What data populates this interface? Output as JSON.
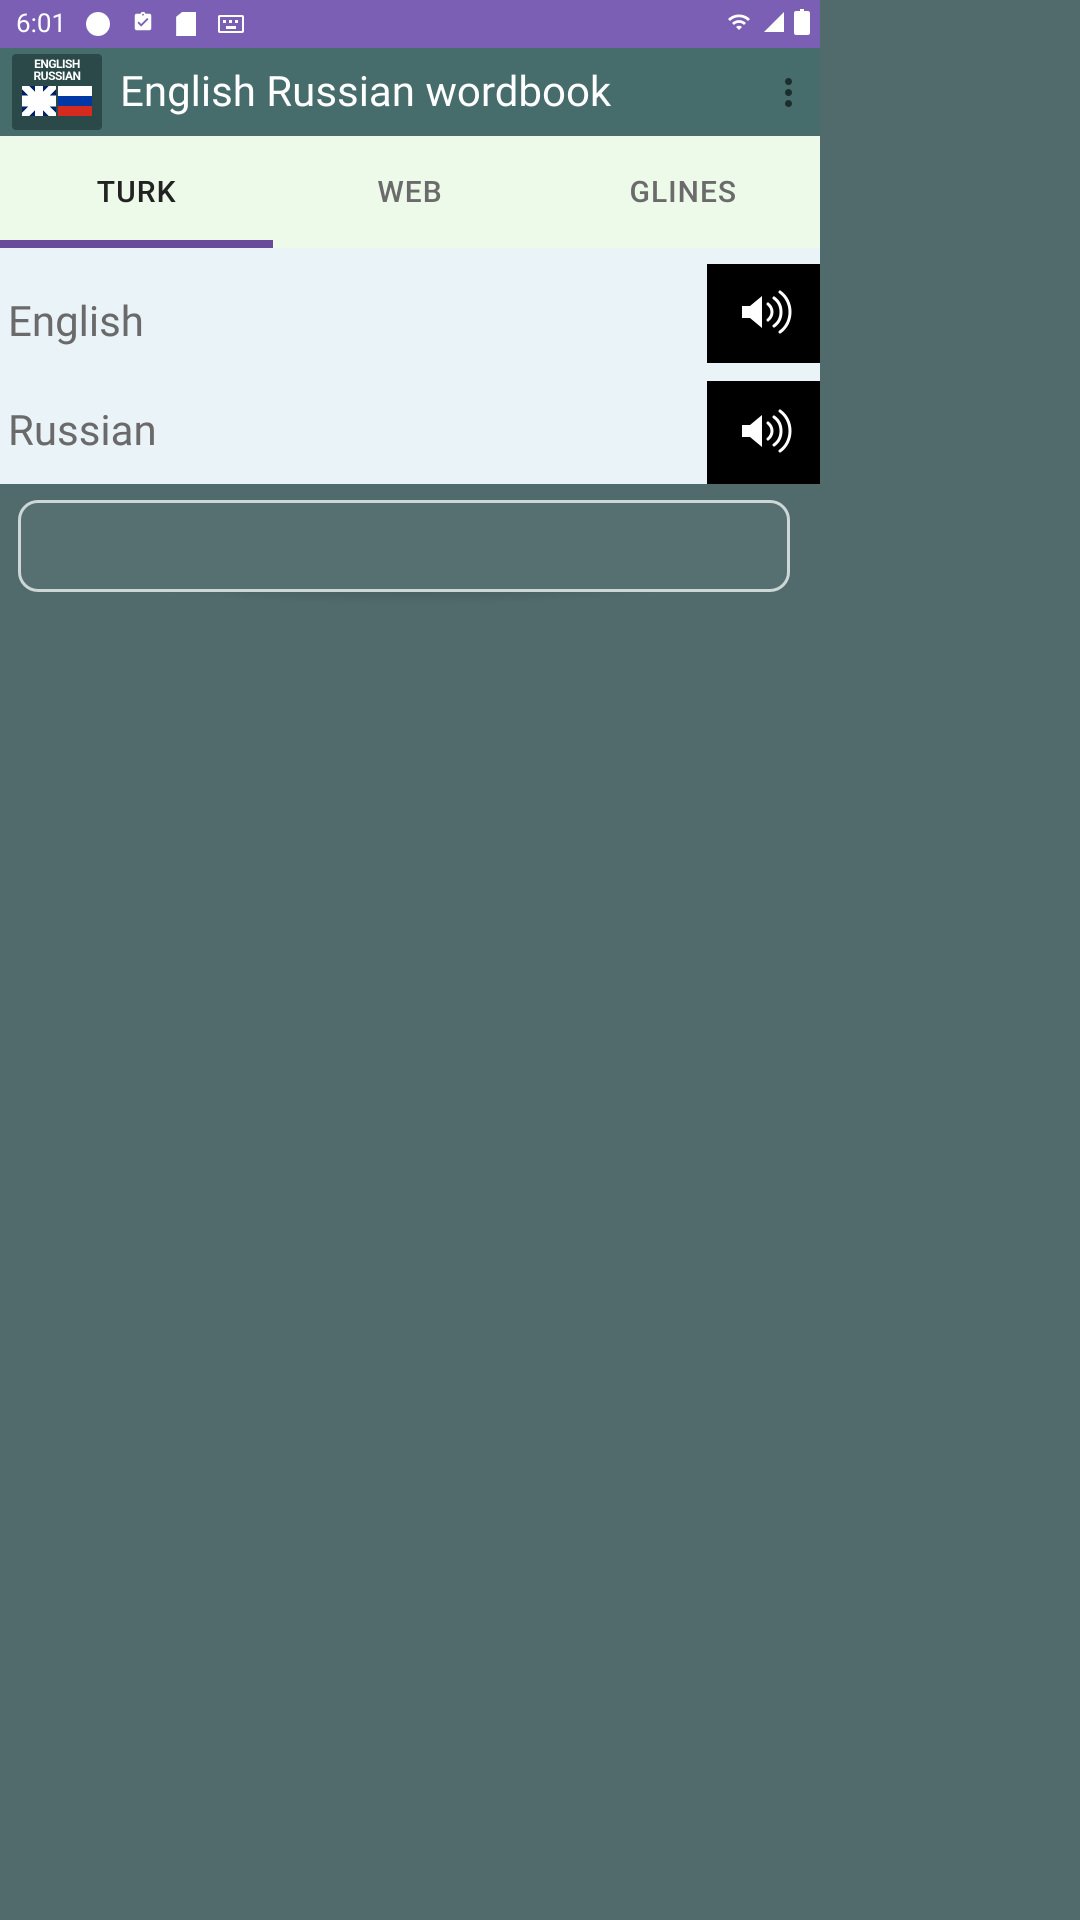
{
  "status": {
    "time": "6:01"
  },
  "header": {
    "title": "English Russian wordbook",
    "logo": {
      "line1": "ENGLISH",
      "line2": "RUSSIAN"
    }
  },
  "tabs": [
    {
      "label": "TURK",
      "active": true
    },
    {
      "label": "WEB",
      "active": false
    },
    {
      "label": "GLINES",
      "active": false
    }
  ],
  "languages": [
    {
      "label": "English"
    },
    {
      "label": "Russian"
    }
  ],
  "input": {
    "value": ""
  }
}
